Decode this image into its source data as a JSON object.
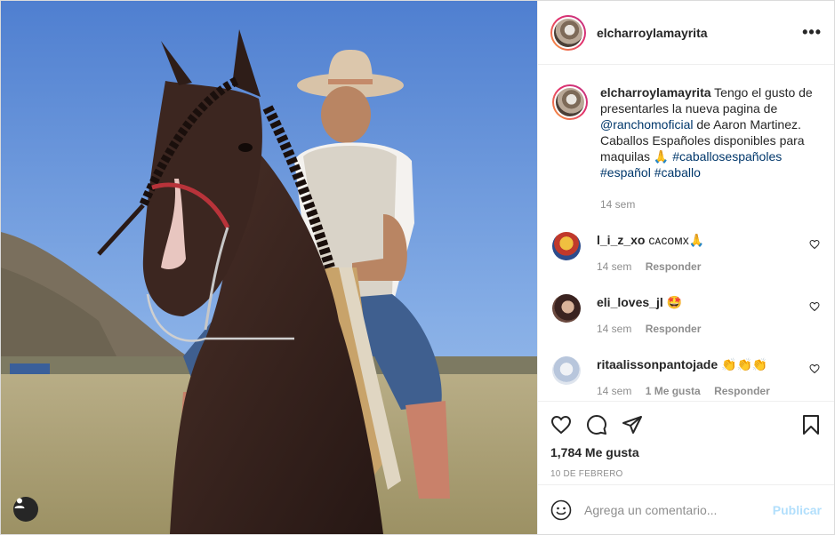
{
  "post": {
    "username": "elcharroylamayrita",
    "more_icon": "more-horizontal-icon"
  },
  "caption": {
    "username": "elcharroylamayrita",
    "text_1": "Tengo el gusto de presentarles la nueva pagina de",
    "mention": "@ranchomoficial",
    "text_2": "de Aaron Martinez. Caballos Españoles disponibles para maquilas 🙏",
    "hashtag_1": "#caballosespañoles",
    "hashtag_2": "#español",
    "hashtag_3": "#caballo",
    "time": "14 sem"
  },
  "comments": [
    {
      "username": "l_i_z_xo",
      "text": "ᴄᴀᴄᴏᴍx🙏",
      "time": "14 sem",
      "likes": "",
      "reply": "Responder"
    },
    {
      "username": "eli_loves_jl",
      "text": "🤩",
      "time": "14 sem",
      "likes": "",
      "reply": "Responder"
    },
    {
      "username": "ritaalissonpantojade",
      "text": "👏👏👏",
      "time": "14 sem",
      "likes": "1 Me gusta",
      "reply": "Responder"
    }
  ],
  "actions": {
    "likes_count": "1,784 Me gusta",
    "date": "10 DE FEBRERO"
  },
  "add_comment": {
    "placeholder": "Agrega un comentario...",
    "publish_label": "Publicar"
  },
  "colors": {
    "link": "#00376b",
    "muted": "#8e8e8e",
    "publish_disabled": "#b2dffc"
  }
}
